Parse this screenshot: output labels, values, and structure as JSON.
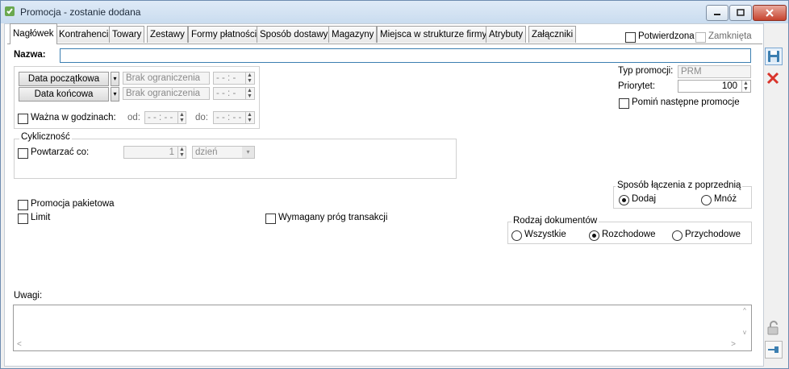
{
  "window": {
    "title": "Promocja - zostanie dodana"
  },
  "tabs": [
    {
      "label": "Nagłówek",
      "active": true
    },
    {
      "label": "Kontrahenci"
    },
    {
      "label": "Towary"
    },
    {
      "label": "Zestawy"
    },
    {
      "label": "Formy płatności"
    },
    {
      "label": "Sposób dostawy"
    },
    {
      "label": "Magazyny"
    },
    {
      "label": "Miejsca w strukturze firmy"
    },
    {
      "label": "Atrybuty"
    },
    {
      "label": "Załączniki"
    }
  ],
  "status": {
    "confirmed_label": "Potwierdzona",
    "closed_label": "Zamknięta"
  },
  "name": {
    "label": "Nazwa:",
    "value": ""
  },
  "dates": {
    "start_button": "Data początkowa",
    "end_button": "Data końcowa",
    "start_value": "Brak ograniczenia",
    "end_value": "Brak ograniczenia",
    "start_time": "- - : -",
    "end_time": "- - : -",
    "valid_hours_label": "Ważna w godzinach:",
    "from_label": "od:",
    "to_label": "do:",
    "from_time": "- - : - -",
    "to_time": "- - : - -"
  },
  "cycle": {
    "legend": "Cykliczność",
    "repeat_label": "Powtarzać co:",
    "repeat_value": "1",
    "unit_value": "dzień"
  },
  "right_panel": {
    "type_label": "Typ promocji:",
    "type_value": "PRM",
    "priority_label": "Priorytet:",
    "priority_value": "100",
    "skip_label": "Pomiń następne promocje"
  },
  "join": {
    "legend": "Sposób łączenia z poprzednią",
    "add_label": "Dodaj",
    "multiply_label": "Mnóż",
    "selected": "add"
  },
  "options": {
    "package_label": "Promocja pakietowa",
    "limit_label": "Limit",
    "threshold_label": "Wymagany próg transakcji"
  },
  "docs": {
    "legend": "Rodzaj dokumentów",
    "all_label": "Wszystkie",
    "outgoing_label": "Rozchodowe",
    "incoming_label": "Przychodowe",
    "selected": "outgoing"
  },
  "notes": {
    "label": "Uwagi:",
    "value": ""
  },
  "colors": {
    "accent": "#3c7fb1",
    "delete": "#d9342b",
    "title_bg": "#d4e3f3"
  }
}
